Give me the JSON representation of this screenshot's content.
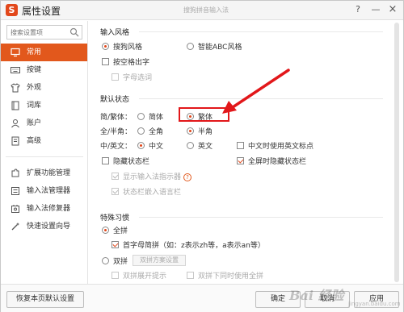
{
  "window": {
    "app_logo": "S",
    "title": "属性设置",
    "subtitle": "搜狗拼音输入法",
    "help": "?",
    "minimize": "—",
    "close": "×"
  },
  "sidebar": {
    "search_placeholder": "搜索设置项",
    "items": [
      {
        "label": "常用",
        "icon": "monitor-icon"
      },
      {
        "label": "按键",
        "icon": "keyboard-icon"
      },
      {
        "label": "外观",
        "icon": "shirt-icon"
      },
      {
        "label": "词库",
        "icon": "book-icon"
      },
      {
        "label": "账户",
        "icon": "user-icon"
      },
      {
        "label": "高级",
        "icon": "document-icon"
      }
    ],
    "tools": [
      {
        "label": "扩展功能管理",
        "icon": "puzzle-icon"
      },
      {
        "label": "输入法管理器",
        "icon": "list-icon"
      },
      {
        "label": "输入法修复器",
        "icon": "repair-icon"
      },
      {
        "label": "快速设置向导",
        "icon": "wizard-icon"
      }
    ]
  },
  "input_style": {
    "title": "输入风格",
    "sogou_style": "搜狗风格",
    "abc_style": "智能ABC风格",
    "space_output": "按空格出字",
    "letter_select": "字母选词"
  },
  "default_state": {
    "title": "默认状态",
    "simp_trad_label": "简/繁体：",
    "simplified": "简体",
    "traditional": "繁体",
    "width_label": "全/半角：",
    "full_width": "全角",
    "half_width": "半角",
    "lang_label": "中/英文：",
    "chinese": "中文",
    "english": "英文",
    "en_punct": "中文时使用英文标点",
    "hide_status": "隐藏状态栏",
    "hide_fullscreen": "全屏时隐藏状态栏",
    "show_indicator": "显示输入法指示器",
    "help_mark": "?",
    "embed_lang": "状态栏嵌入语言栏"
  },
  "special": {
    "title": "特殊习惯",
    "full_pinyin": "全拼",
    "initial_abbr": "首字母简拼（如：z表示zh等，a表示an等）",
    "double_pinyin": "双拼",
    "double_scheme": "双拼方案设置",
    "double_expand": "双拼展开提示",
    "double_fullpinyin": "双拼下同时使用全拼"
  },
  "footer": {
    "restore": "恢复本页默认设置",
    "ok": "确定",
    "cancel": "取消",
    "apply": "应用"
  },
  "watermark": {
    "brand": "Bai 经验",
    "domain": "jingyan.baidu.com"
  },
  "colors": {
    "accent": "#e2581c",
    "annotation": "#e2171a"
  }
}
